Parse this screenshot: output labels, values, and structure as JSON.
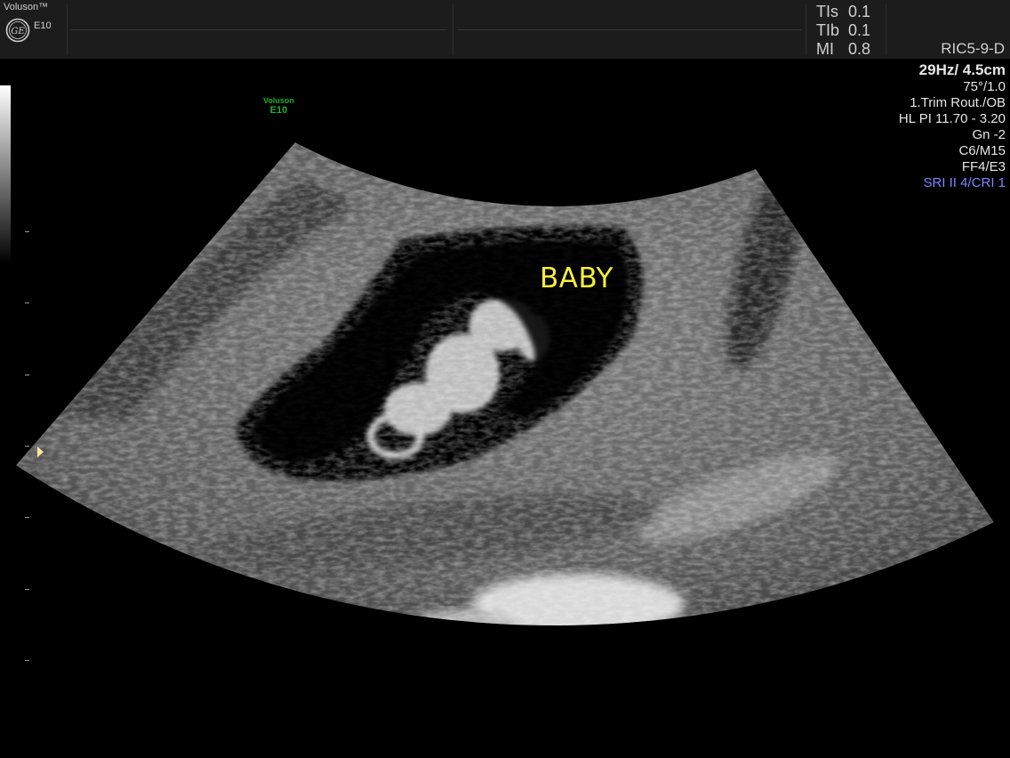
{
  "header": {
    "brand_name": "Voluson™",
    "brand_model": "E10",
    "logo": "ge-logo",
    "indices": [
      {
        "label": "TIs",
        "value": "0.1"
      },
      {
        "label": "TIb",
        "value": "0.1"
      },
      {
        "label": "MI",
        "value": "0.8"
      }
    ],
    "probe": "RIC5-9-D"
  },
  "params": {
    "frame_depth": "29Hz/ 4.5cm",
    "angle": "75°/1.0",
    "preset": "1.Trim Rout./OB",
    "harmonics": "HL PI 11.70 - 3.20",
    "gain": "Gn  -2",
    "map": "C6/M15",
    "filter": "FF4/E3",
    "sri": "SRI II 4/CRI 1"
  },
  "watermark": {
    "line1": "Voluson",
    "line2": "E10"
  },
  "annotation": {
    "text": "BABY",
    "color": "#f6ee3a"
  },
  "colors": {
    "sri": "#7a86ff",
    "watermark": "#1fae2c",
    "header_bg": "#1c1c1c"
  }
}
